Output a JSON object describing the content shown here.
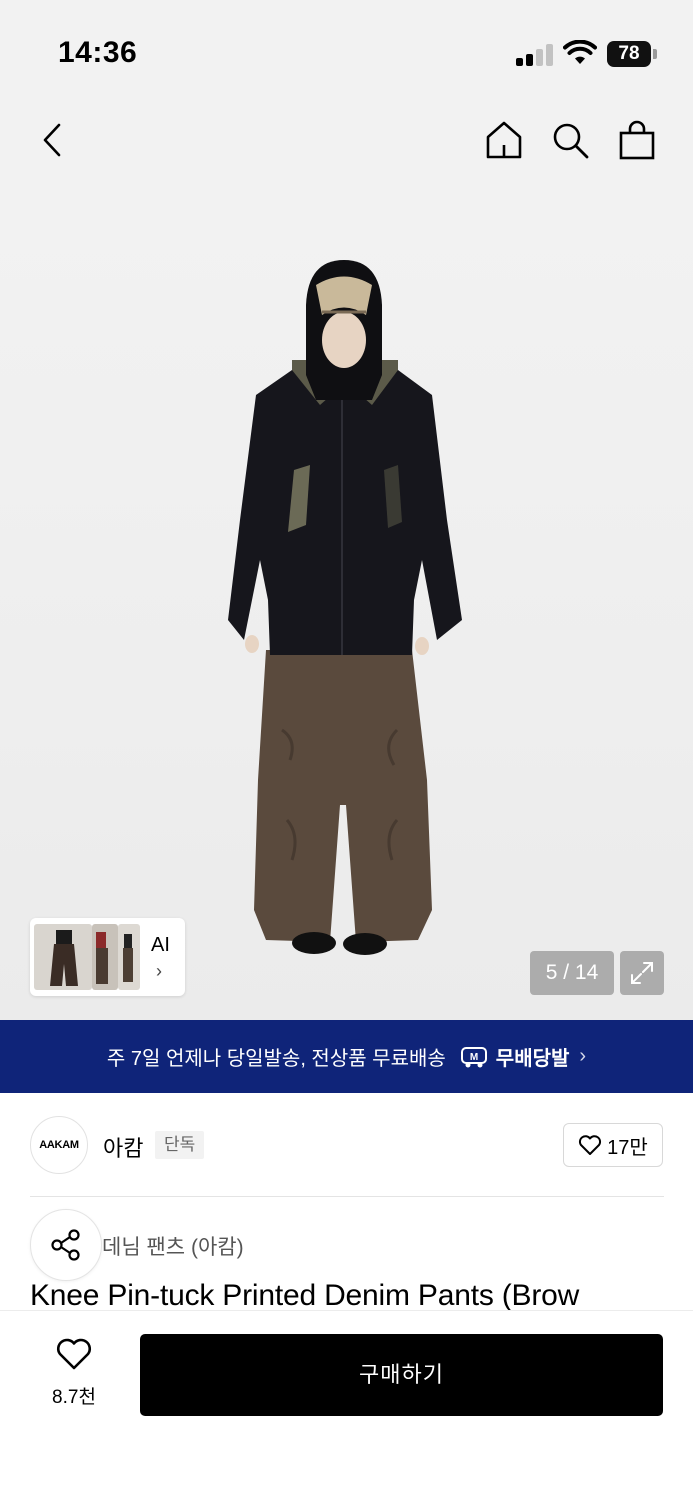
{
  "status_bar": {
    "time": "14:36",
    "battery": "78"
  },
  "nav": {
    "back_icon": "chevron-left-icon",
    "home_icon": "home-icon",
    "search_icon": "search-icon",
    "bag_icon": "shopping-bag-icon"
  },
  "gallery": {
    "ai_label": "AI",
    "ai_chevron": "›",
    "counter": "5 / 14",
    "current_index": 5,
    "total": 14
  },
  "banner": {
    "text": "주 7일 언제나 당일발송, 전상품 무료배송",
    "badge": "무배당발",
    "chevron": "›",
    "color": "#0f2479"
  },
  "brand": {
    "logo_text": "AAKAM",
    "name": "아캄",
    "tag": "단독",
    "likes": "17만"
  },
  "product": {
    "category": "데님 팬츠 (아캄)",
    "title": "Knee Pin-tuck Printed Denim Pants (Brow"
  },
  "bottom_bar": {
    "wish_count": "8.7천",
    "buy_label": "구매하기"
  }
}
